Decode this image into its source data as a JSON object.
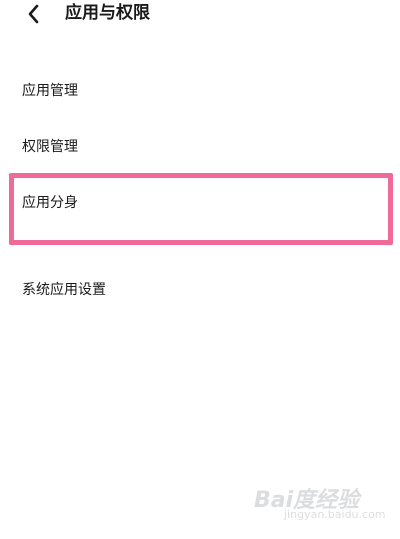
{
  "header": {
    "title": "应用与权限",
    "back_icon": "chevron-left-icon"
  },
  "menu": {
    "items": [
      {
        "id": "app-management",
        "label": "应用管理"
      },
      {
        "id": "permission-management",
        "label": "权限管理"
      },
      {
        "id": "app-clone",
        "label": "应用分身",
        "highlighted": true
      },
      {
        "id": "system-app-settings",
        "label": "系统应用设置"
      }
    ]
  },
  "annotation": {
    "highlight_color": "#f06a99"
  },
  "watermark": {
    "text": "Bai度经验",
    "subtext": "jingyan.baidu.com"
  }
}
